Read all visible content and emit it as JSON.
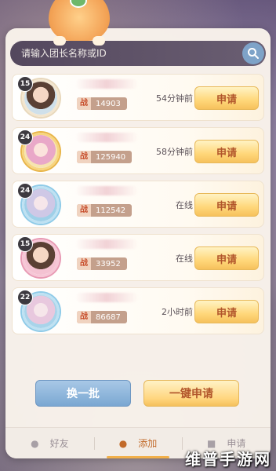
{
  "search": {
    "placeholder": "请输入团长名称或ID"
  },
  "members": [
    {
      "level": "15",
      "power_label": "战",
      "power": "14903",
      "status": "54分钟前",
      "apply_label": "申请"
    },
    {
      "level": "24",
      "power_label": "战",
      "power": "125940",
      "status": "58分钟前",
      "apply_label": "申请"
    },
    {
      "level": "24",
      "power_label": "战",
      "power": "112542",
      "status": "在线",
      "apply_label": "申请"
    },
    {
      "level": "15",
      "power_label": "战",
      "power": "33952",
      "status": "在线",
      "apply_label": "申请"
    },
    {
      "level": "22",
      "power_label": "战",
      "power": "86687",
      "status": "2小时前",
      "apply_label": "申请"
    }
  ],
  "actions": {
    "refresh_label": "换一批",
    "apply_all_label": "一键申请"
  },
  "tabs": [
    {
      "label": "好友",
      "icon": "person-icon",
      "active": false
    },
    {
      "label": "添加",
      "icon": "add-person-icon",
      "active": true
    },
    {
      "label": "申请",
      "icon": "document-icon",
      "active": false
    }
  ],
  "watermark": "维普手游网",
  "colors": {
    "accent": "#c26a2a",
    "apply_button": "#ffd77a",
    "refresh_button": "#7aa7d2",
    "power_badge": "#c4a08c"
  }
}
